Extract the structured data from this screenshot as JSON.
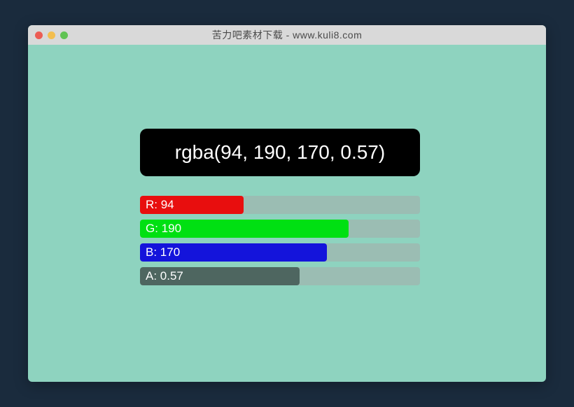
{
  "window": {
    "title": "苦力吧素材下载 - www.kuli8.com"
  },
  "color": {
    "display": "rgba(94, 190, 170, 0.57)",
    "r": {
      "label": "R: 94",
      "percent": 36.9
    },
    "g": {
      "label": "G: 190",
      "percent": 74.5
    },
    "b": {
      "label": "B: 170",
      "percent": 66.7
    },
    "a": {
      "label": "A: 0.57",
      "percent": 57
    }
  }
}
